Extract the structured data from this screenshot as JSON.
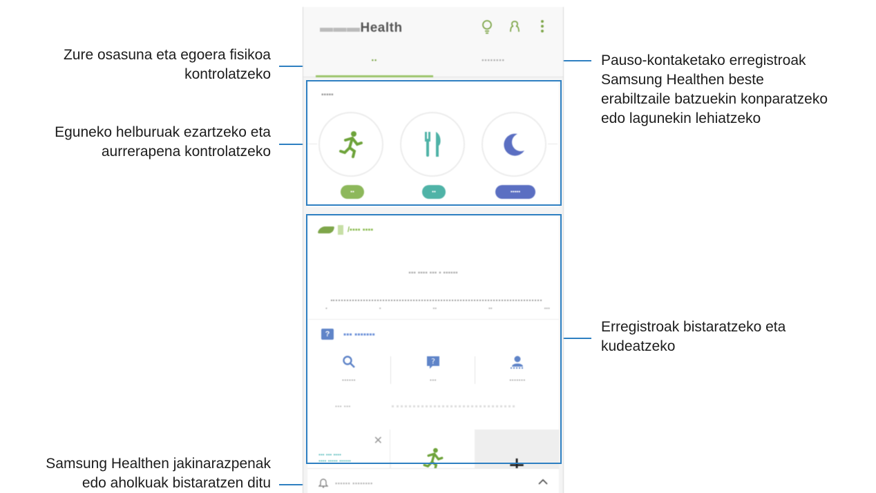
{
  "callouts": {
    "left_1": [
      "Zure osasuna eta egoera fisikoa",
      "kontrolatzeko"
    ],
    "left_2": [
      "Eguneko helburuak ezartzeko eta",
      "aurrerapena kontrolatzeko"
    ],
    "left_3": [
      "Samsung Healthen jakinarazpenak",
      "edo aholkuak bistaratzen ditu"
    ],
    "right_1": [
      "Pauso-kontaketako erregistroak",
      "Samsung Healthen beste",
      "erabiltzaile batzuekin konparatzeko",
      "edo lagunekin lehiatzeko"
    ],
    "right_2": [
      "Erregistroak bistaratzeko eta",
      "kudeatzeko"
    ]
  },
  "colors": {
    "annotation_line": "#2d7fc1",
    "accent_green": "#7ea64a",
    "accent_teal": "#4fb3a7",
    "accent_purple": "#5b6fc2"
  },
  "icons": {
    "tips": "lightbulb-icon",
    "together": "people-icon",
    "more": "more-vert-icon",
    "goal_activity": "runner-icon",
    "goal_food": "fork-knife-icon",
    "goal_sleep": "moon-icon",
    "steps": "shoe-icon",
    "experts": "question-icon",
    "search": "search-icon",
    "ask": "ask-icon",
    "premium": "premium-icon",
    "close": "close-icon",
    "add": "plus-icon",
    "messages": "bell-icon",
    "expand": "chevron-up-icon"
  }
}
